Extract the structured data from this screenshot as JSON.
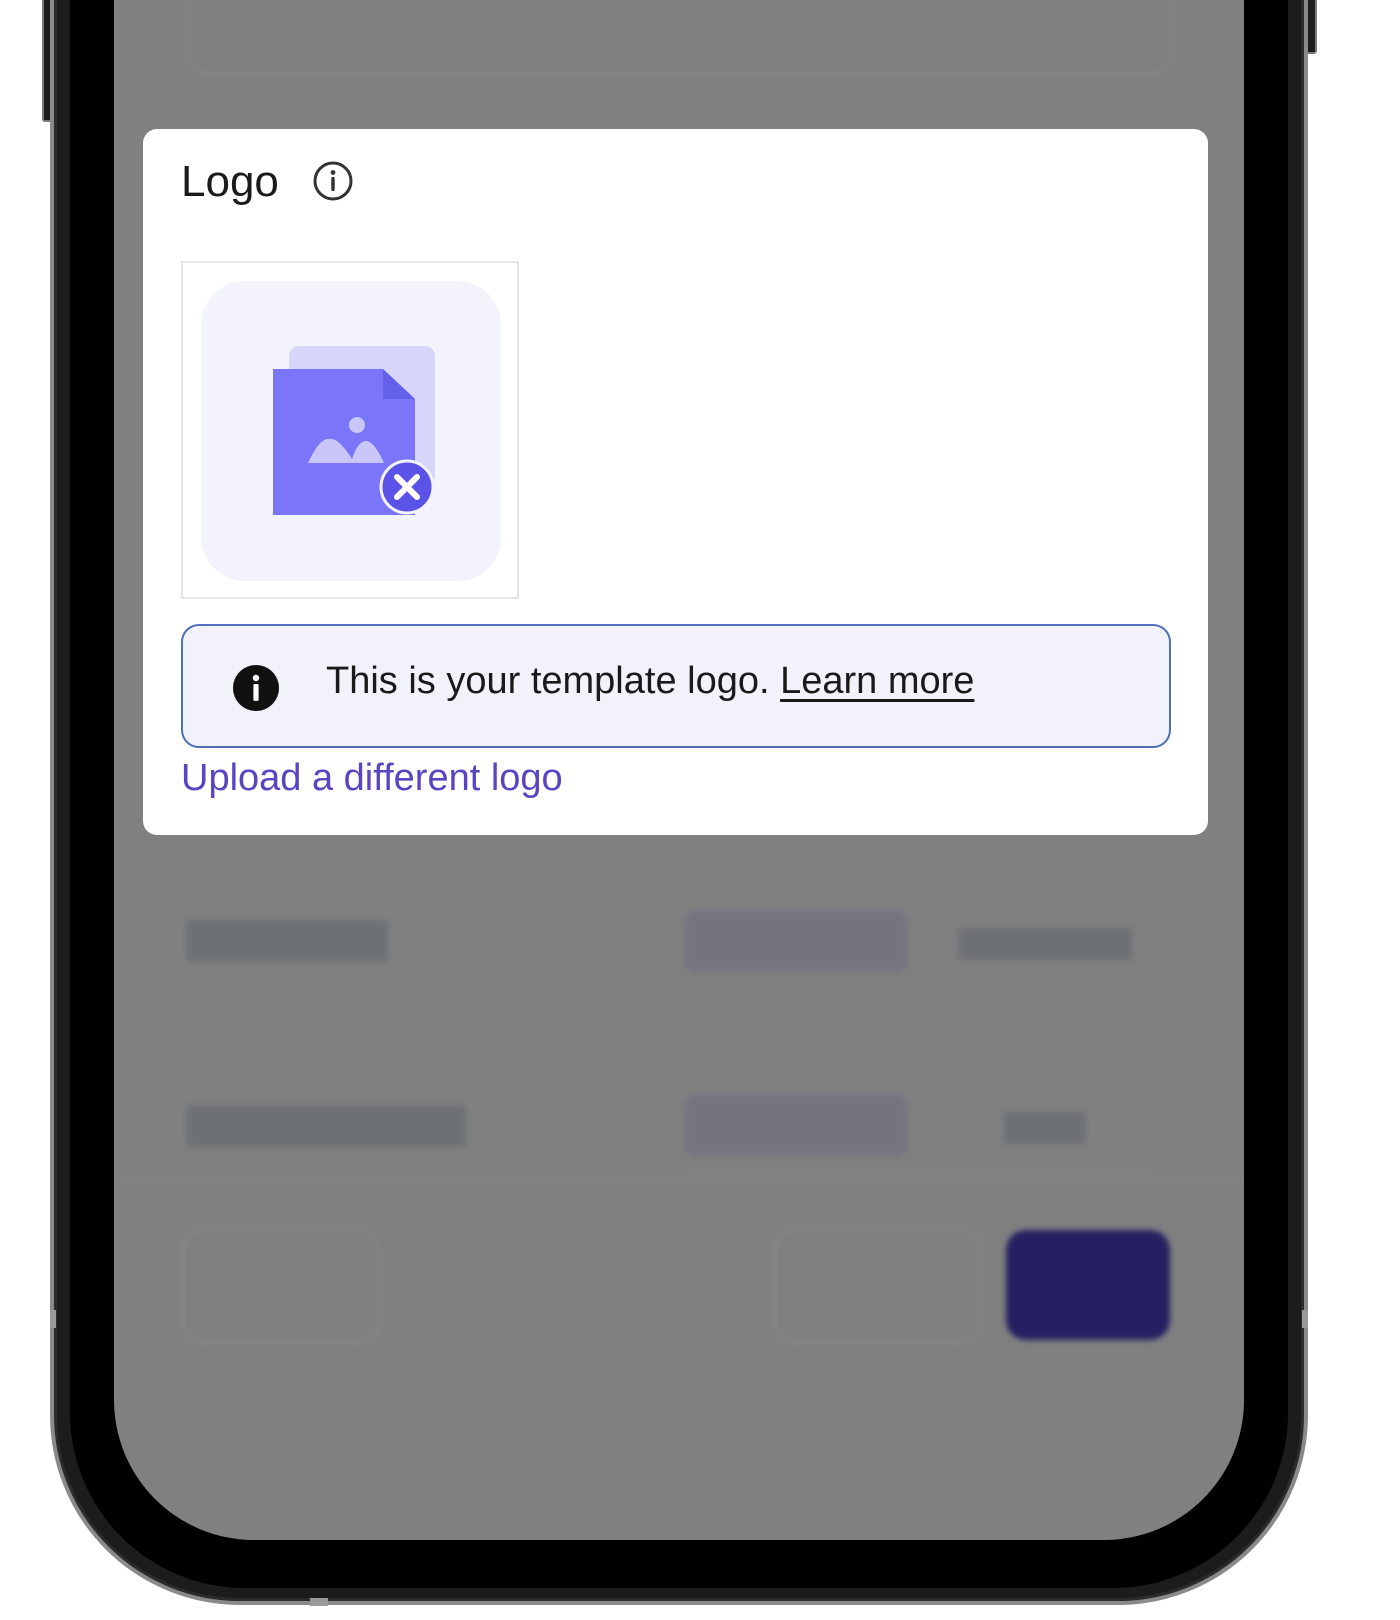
{
  "logo_card": {
    "title": "Logo",
    "title_info_icon": "info-outline-icon",
    "logo_placeholder_icon": "image-missing-icon",
    "notice": {
      "icon": "info-filled-icon",
      "text": "This is your template logo.",
      "link_label": "Learn more"
    },
    "upload_link_label": "Upload a different logo"
  },
  "colors": {
    "accent": "#5944c4",
    "notice_border": "#4f6fb8",
    "notice_background": "#f2f3fa",
    "placeholder_file": "#7b76f9",
    "placeholder_file_back": "#d6d6fb",
    "primary_button_dimmed": "#252062"
  }
}
